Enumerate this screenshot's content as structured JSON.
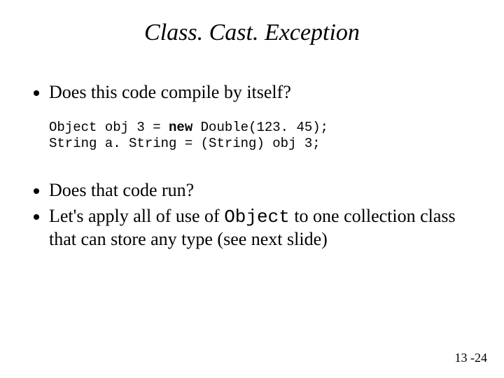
{
  "title": "Class. Cast. Exception",
  "bullets": {
    "b1": "Does this code compile by itself?",
    "b2": "Does that code run?",
    "b3_pre": "Let's apply all of use of ",
    "b3_mono": "Object",
    "b3_post": " to one collection class that can store any type (see next slide)"
  },
  "code": {
    "line1_a": "Object obj 3 = ",
    "line1_kw": "new",
    "line1_b": " Double(123. 45);",
    "line2": "String a. String = (String) obj 3;"
  },
  "pagenum": "13 -24"
}
